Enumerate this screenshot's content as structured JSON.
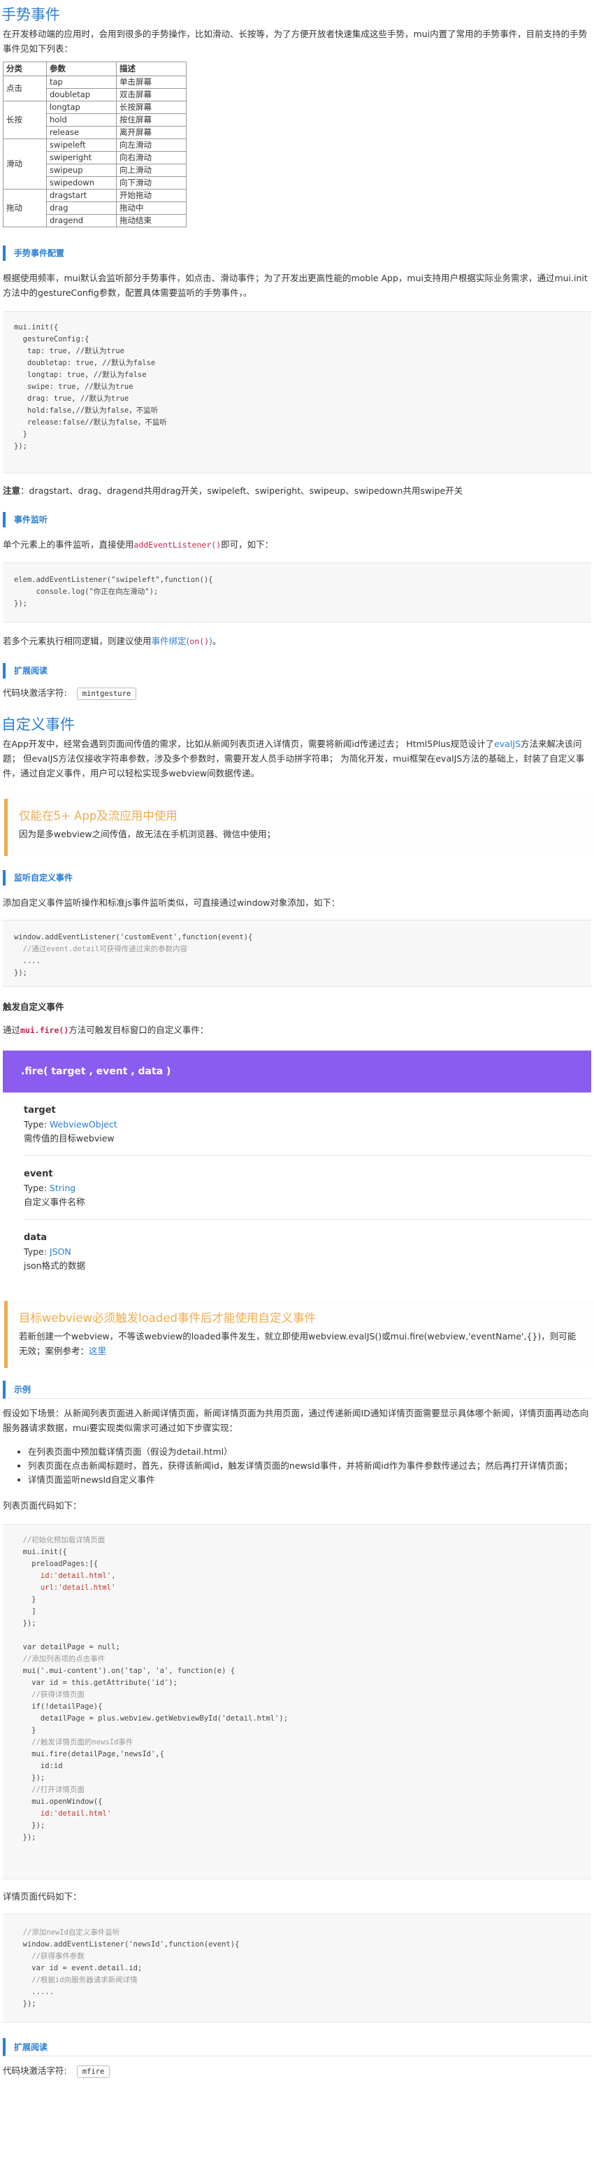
{
  "gesture": {
    "title": "手势事件",
    "intro": "在开发移动端的应用时，会用到很多的手势操作，比如滑动、长按等，为了方便开放者快速集成这些手势，mui内置了常用的手势事件，目前支持的手势事件见如下列表：",
    "table": {
      "headers": [
        "分类",
        "参数",
        "描述"
      ],
      "groups": [
        {
          "category": "点击",
          "rows": [
            [
              "tap",
              "单击屏幕"
            ],
            [
              "doubletap",
              "双击屏幕"
            ]
          ]
        },
        {
          "category": "长按",
          "rows": [
            [
              "longtap",
              "长按屏幕"
            ],
            [
              "hold",
              "按住屏幕"
            ],
            [
              "release",
              "离开屏幕"
            ]
          ]
        },
        {
          "category": "滑动",
          "rows": [
            [
              "swipeleft",
              "向左滑动"
            ],
            [
              "swiperight",
              "向右滑动"
            ],
            [
              "swipeup",
              "向上滑动"
            ],
            [
              "swipedown",
              "向下滑动"
            ]
          ]
        },
        {
          "category": "拖动",
          "rows": [
            [
              "dragstart",
              "开始拖动"
            ],
            [
              "drag",
              "拖动中"
            ],
            [
              "dragend",
              "拖动结束"
            ]
          ]
        }
      ]
    },
    "config_heading": "手势事件配置",
    "config_text": "根据使用频率，mui默认会监听部分手势事件，如点击、滑动事件；为了开发出更高性能的moble App，mui支持用户根据实际业务需求，通过mui.init方法中的gestureConfig参数，配置具体需要监听的手势事件，。",
    "config_code": [
      "mui.init({",
      "  gestureConfig:{",
      "   tap: true, //默认为true",
      "   doubletap: true, //默认为false",
      "   longtap: true, //默认为false",
      "   swipe: true, //默认为true",
      "   drag: true, //默认为true",
      "   hold:false,//默认为false，不监听",
      "   release:false//默认为false，不监听",
      "  }",
      "});"
    ],
    "note_label": "注意",
    "note_text": "：dragstart、drag、dragend共用drag开关，swipeleft、swiperight、swipeup、swipedown共用swipe开关",
    "listen_heading": "事件监听",
    "listen_text_pre": "单个元素上的事件监听，直接使用",
    "listen_text_code": "addEventListener()",
    "listen_text_post": "即可，如下：",
    "listen_code": [
      "elem.addEventListener(\"swipeleft\",function(){",
      "     console.log(\"你正在向左滑动\");",
      "});"
    ],
    "multi_pre": "若多个元素执行相同逻辑，则建议使用",
    "multi_link": "事件绑定",
    "multi_code": "on()",
    "multi_post": "。",
    "ext_heading": "扩展阅读",
    "ext_label": "代码块激活字符:",
    "ext_kbd": "mintgesture"
  },
  "custom": {
    "title": "自定义事件",
    "intro_1": "在App开发中，经常会遇到页面间传值的需求，比如从新闻列表页进入详情页，需要将新闻id传递过去；  Html5Plus规范设计了",
    "intro_link": "evalJS",
    "intro_2": "方法来解决该问题；  但evalJS方法仅接收字符串参数，涉及多个参数时，需要开发人员手动拼字符串；  为简化开发，mui框架在evalJS方法的基础上，封装了自定义事件，通过自定义事件，用户可以轻松实现多webview间数据传递。",
    "note1_title": "仅能在5+ App及流应用中使用",
    "note1_body": "因为是多webview之间传值，故无法在手机浏览器、微信中使用；",
    "listen_heading": "监听自定义事件",
    "listen_text": "添加自定义事件监听操作和标准js事件监听类似，可直接通过window对象添加，如下：",
    "listen_code": [
      "window.addEventListener('customEvent',function(event){",
      "  //通过event.detail可获得传递过来的参数内容",
      "  ....",
      "});"
    ],
    "trigger_heading": "触发自定义事件",
    "trigger_pre": "通过",
    "trigger_code": "mui.fire()",
    "trigger_post": "方法可触发目标窗口的自定义事件：",
    "api_signature": ".fire( target , event , data )",
    "api_params": [
      {
        "name": "target",
        "type_label": "Type: ",
        "type": "WebviewObject",
        "desc": "需传值的目标webview"
      },
      {
        "name": "event",
        "type_label": "Type: ",
        "type": "String",
        "desc": "自定义事件名称"
      },
      {
        "name": "data",
        "type_label": "Type: ",
        "type": "JSON",
        "desc": "json格式的数据"
      }
    ],
    "note2_title": "目标webview必须触发loaded事件后才能使用自定义事件",
    "note2_body": "若新创建一个webview，不等该webview的loaded事件发生，就立即使用webview.evalJS()或mui.fire(webview,'eventName',{})，则可能无效；案例参考：",
    "note2_link": "这里",
    "example_heading": "示例",
    "example_text": "假设如下场景：从新闻列表页面进入新闻详情页面，新闻详情页面为共用页面，通过传递新闻ID通知详情页面需要显示具体哪个新闻，详情页面再动态向服务器请求数据，mui要实现类似需求可通过如下步骤实现：",
    "bullets": [
      "在列表页面中预加载详情页面（假设为detail.html）",
      "列表页面在点击新闻标题时，首先，获得该新闻id，触发详情页面的newsId事件，并将新闻id作为事件参数传递过去；然后再打开详情页面；",
      "详情页面监听newsId自定义事件"
    ],
    "list_label": "列表页面代码如下：",
    "list_code": [
      "  //初始化预加载详情页面",
      "  mui.init({",
      "    preloadPages:[{",
      "      id:'detail.html',",
      "      url:'detail.html'",
      "    }",
      "    ]",
      "  });",
      "",
      "  var detailPage = null;",
      "  //添加列表项的点击事件",
      "  mui('.mui-content').on('tap', 'a', function(e) {",
      "    var id = this.getAttribute('id');",
      "    //获得详情页面",
      "    if(!detailPage){",
      "      detailPage = plus.webview.getWebviewById('detail.html');",
      "    }",
      "    //触发详情页面的newsId事件",
      "    mui.fire(detailPage,'newsId',{",
      "      id:id",
      "    });",
      "    //打开详情页面",
      "    mui.openWindow({",
      "      id:'detail.html'",
      "    });",
      "  });"
    ],
    "detail_label": "详情页面代码如下：",
    "detail_code": [
      "  //添加newId自定义事件监听",
      "  window.addEventListener('newsId',function(event){",
      "    //获得事件参数",
      "    var id = event.detail.id;",
      "    //根据id向服务器请求新闻详情",
      "    .....",
      "  });"
    ],
    "ext_heading": "扩展阅读",
    "ext_label": "代码块激活字符:",
    "ext_kbd": "mfire"
  }
}
